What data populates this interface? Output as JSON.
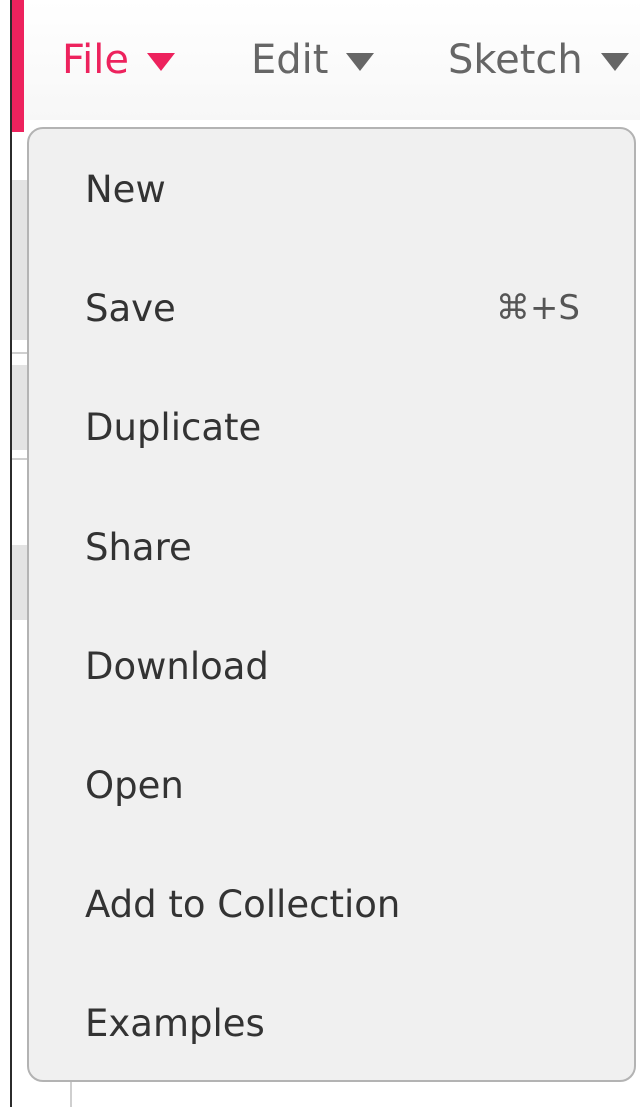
{
  "menubar": {
    "menus": [
      {
        "label": "File",
        "active": true
      },
      {
        "label": "Edit",
        "active": false
      },
      {
        "label": "Sketch",
        "active": false
      }
    ]
  },
  "file_menu": {
    "items": [
      {
        "label": "New",
        "shortcut": ""
      },
      {
        "label": "Save",
        "shortcut": "⌘+S"
      },
      {
        "label": "Duplicate",
        "shortcut": ""
      },
      {
        "label": "Share",
        "shortcut": ""
      },
      {
        "label": "Download",
        "shortcut": ""
      },
      {
        "label": "Open",
        "shortcut": ""
      },
      {
        "label": "Add to Collection",
        "shortcut": ""
      },
      {
        "label": "Examples",
        "shortcut": ""
      }
    ]
  },
  "colors": {
    "accent": "#ed225d",
    "menu_text": "#666666",
    "dropdown_bg": "#f0f0f0"
  },
  "icons": {
    "caret": "caret-down-icon"
  }
}
